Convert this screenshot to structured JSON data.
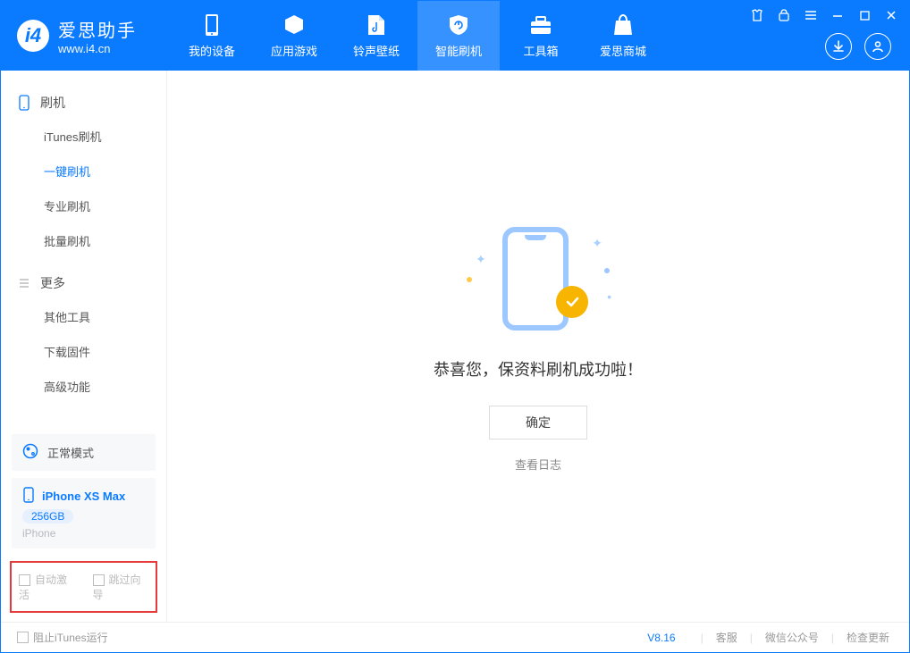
{
  "logo": {
    "name": "爱思助手",
    "url": "www.i4.cn"
  },
  "nav": {
    "items": [
      {
        "label": "我的设备"
      },
      {
        "label": "应用游戏"
      },
      {
        "label": "铃声壁纸"
      },
      {
        "label": "智能刷机"
      },
      {
        "label": "工具箱"
      },
      {
        "label": "爱思商城"
      }
    ]
  },
  "sidebar": {
    "sections": [
      {
        "title": "刷机",
        "items": [
          {
            "label": "iTunes刷机"
          },
          {
            "label": "一键刷机"
          },
          {
            "label": "专业刷机"
          },
          {
            "label": "批量刷机"
          }
        ]
      },
      {
        "title": "更多",
        "items": [
          {
            "label": "其他工具"
          },
          {
            "label": "下载固件"
          },
          {
            "label": "高级功能"
          }
        ]
      }
    ],
    "mode_card": {
      "label": "正常模式"
    },
    "device_card": {
      "name": "iPhone XS Max",
      "storage": "256GB",
      "type": "iPhone"
    },
    "checks": {
      "auto_activate": "自动激活",
      "skip_guide": "跳过向导"
    }
  },
  "main": {
    "success_text": "恭喜您，保资料刷机成功啦！",
    "ok_button": "确定",
    "log_link": "查看日志"
  },
  "footer": {
    "block_itunes": "阻止iTunes运行",
    "version": "V8.16",
    "links": {
      "support": "客服",
      "wechat": "微信公众号",
      "update": "检查更新"
    }
  }
}
